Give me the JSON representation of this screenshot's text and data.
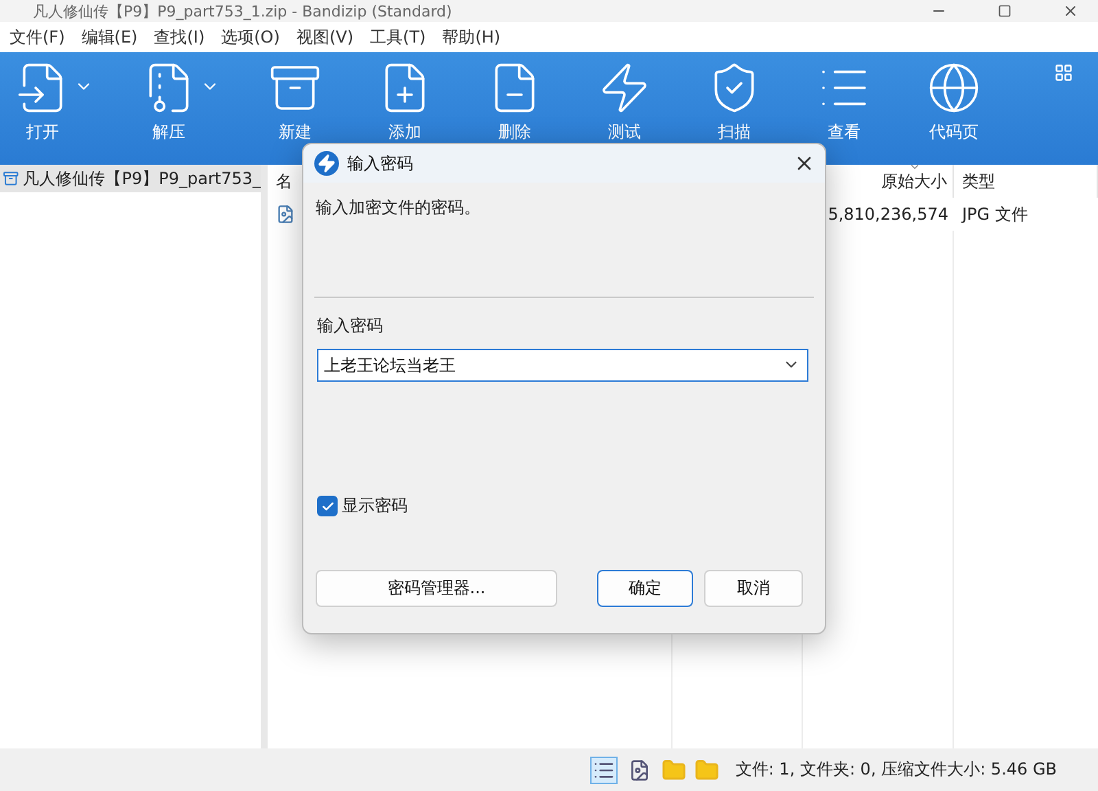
{
  "window": {
    "title": "凡人修仙传【P9】P9_part753_1.zip - Bandizip (Standard)"
  },
  "menu": [
    "文件(F)",
    "编辑(E)",
    "查找(I)",
    "选项(O)",
    "视图(V)",
    "工具(T)",
    "帮助(H)"
  ],
  "toolbar": [
    {
      "label": "打开",
      "kind": "open",
      "dropdown": true
    },
    {
      "label": "解压",
      "kind": "extract",
      "dropdown": true
    },
    {
      "label": "新建",
      "kind": "new",
      "dropdown": false
    },
    {
      "label": "添加",
      "kind": "add",
      "dropdown": false
    },
    {
      "label": "删除",
      "kind": "delete",
      "dropdown": false
    },
    {
      "label": "测试",
      "kind": "test",
      "dropdown": false
    },
    {
      "label": "扫描",
      "kind": "scan",
      "dropdown": false
    },
    {
      "label": "查看",
      "kind": "view",
      "dropdown": false
    },
    {
      "label": "代码页",
      "kind": "codepage",
      "dropdown": false
    }
  ],
  "tree": [
    {
      "label": "凡人修仙传【P9】P9_part753_",
      "selected": true
    }
  ],
  "file_list": {
    "columns": [
      {
        "label": "名",
        "sorted": false
      },
      {
        "label": "原始大小",
        "sorted": true
      },
      {
        "label": "类型",
        "sorted": false
      }
    ],
    "rows": [
      {
        "size": "5,810,236,574",
        "type": "JPG 文件"
      }
    ]
  },
  "dialog": {
    "title": "输入密码",
    "message": "输入加密文件的密码。",
    "field_label": "输入密码",
    "value": "上老王论坛当老王",
    "show_password": {
      "label": "显示密码",
      "checked": true
    },
    "buttons": [
      {
        "label": "密码管理器...",
        "default": false
      },
      {
        "label": "确定",
        "default": true
      },
      {
        "label": "取消",
        "default": false
      }
    ]
  },
  "status_bar": {
    "views": [
      {
        "kind": "details",
        "selected": true
      },
      {
        "kind": "thumbnails",
        "selected": false
      }
    ],
    "text": "文件: 1, 文件夹: 0, 压缩文件大小: 5.46 GB"
  }
}
